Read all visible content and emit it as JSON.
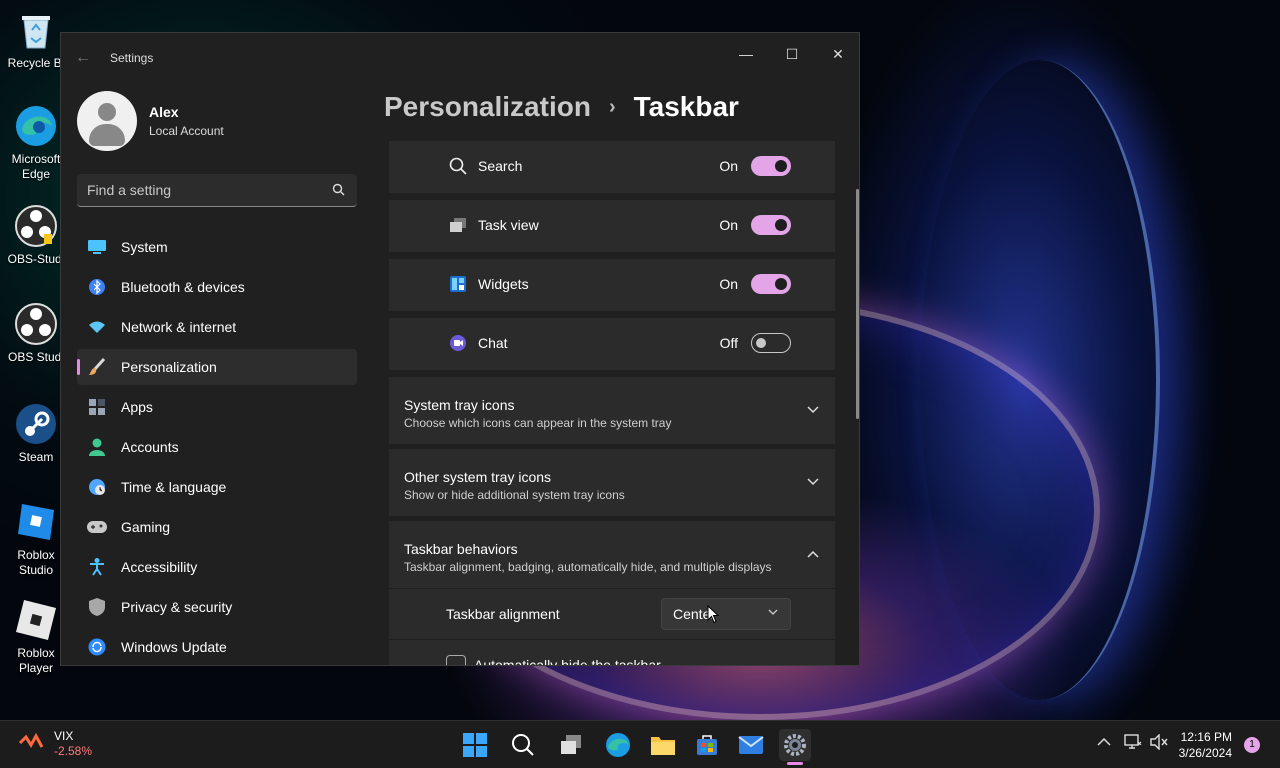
{
  "desktop": {
    "icons": [
      {
        "label": "Recycle Bi",
        "icon": "recycle-bin-icon"
      },
      {
        "label": "Microsoft Edge",
        "icon": "edge-icon"
      },
      {
        "label": "OBS-Studi",
        "icon": "obs-icon"
      },
      {
        "label": "OBS Studi",
        "icon": "obs-icon"
      },
      {
        "label": "Steam",
        "icon": "steam-icon"
      },
      {
        "label": "Roblox Studio",
        "icon": "roblox-studio-icon"
      },
      {
        "label": "Roblox Player",
        "icon": "roblox-player-icon"
      }
    ]
  },
  "window": {
    "title": "Settings",
    "controls": {
      "minimize": "—",
      "maximize": "☐",
      "close": "✕"
    }
  },
  "profile": {
    "name": "Alex",
    "account_type": "Local Account"
  },
  "search": {
    "placeholder": "Find a setting"
  },
  "nav": {
    "items": [
      {
        "label": "System",
        "icon": "system-icon",
        "color": "#4cc2ff"
      },
      {
        "label": "Bluetooth & devices",
        "icon": "bluetooth-icon",
        "color": "#3b82f6"
      },
      {
        "label": "Network & internet",
        "icon": "wifi-icon",
        "color": "#5ec6f5"
      },
      {
        "label": "Personalization",
        "icon": "brush-icon",
        "color": "#f0a85a",
        "active": true
      },
      {
        "label": "Apps",
        "icon": "apps-icon",
        "color": "#9aa5b5"
      },
      {
        "label": "Accounts",
        "icon": "accounts-icon",
        "color": "#3ec98f"
      },
      {
        "label": "Time & language",
        "icon": "globe-clock-icon",
        "color": "#4fa6ff"
      },
      {
        "label": "Gaming",
        "icon": "controller-icon",
        "color": "#c8c8c8"
      },
      {
        "label": "Accessibility",
        "icon": "accessibility-icon",
        "color": "#4cc2ff"
      },
      {
        "label": "Privacy & security",
        "icon": "shield-icon",
        "color": "#a8a8a8"
      },
      {
        "label": "Windows Update",
        "icon": "update-icon",
        "color": "#2f8cff"
      }
    ]
  },
  "breadcrumb": {
    "parent": "Personalization",
    "separator": "›",
    "current": "Taskbar"
  },
  "taskbar_items": [
    {
      "label": "Search",
      "state": "On",
      "on": true,
      "icon": "search-icon"
    },
    {
      "label": "Task view",
      "state": "On",
      "on": true,
      "icon": "task-view-icon"
    },
    {
      "label": "Widgets",
      "state": "On",
      "on": true,
      "icon": "widgets-icon"
    },
    {
      "label": "Chat",
      "state": "Off",
      "on": false,
      "icon": "chat-icon"
    }
  ],
  "groups": {
    "system_tray": {
      "title": "System tray icons",
      "subtitle": "Choose which icons can appear in the system tray",
      "chevron": "⌄"
    },
    "other_tray": {
      "title": "Other system tray icons",
      "subtitle": "Show or hide additional system tray icons",
      "chevron": "⌄"
    },
    "behaviors": {
      "title": "Taskbar behaviors",
      "subtitle": "Taskbar alignment, badging, automatically hide, and multiple displays",
      "chevron": "⌃"
    }
  },
  "behaviors": {
    "alignment_label": "Taskbar alignment",
    "alignment_value": "Center",
    "auto_hide_label": "Automatically hide the taskbar"
  },
  "taskbar": {
    "widget": {
      "symbol": "VIX",
      "change": "-2.58%"
    },
    "time": "12:16 PM",
    "date": "3/26/2024",
    "notifications": "1",
    "accent": "#e68ae5"
  }
}
